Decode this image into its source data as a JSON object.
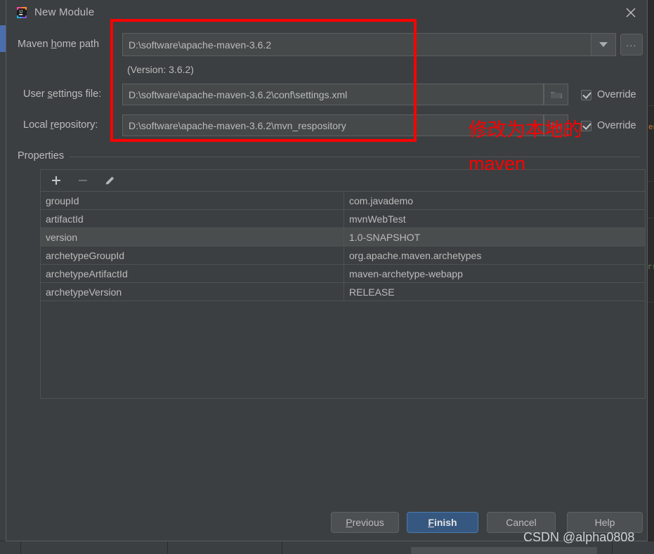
{
  "window": {
    "title": "New Module",
    "app_icon": "intellij-idea-icon",
    "close_icon": "close-icon"
  },
  "form": {
    "maven_home": {
      "label_pre": "Maven ",
      "label_mnemonic": "h",
      "label_post": "ome path",
      "value": "D:\\software\\apache-maven-3.6.2",
      "dropdown_icon": "chevron-down-icon",
      "browse_label": "..."
    },
    "version_note": "(Version: 3.6.2)",
    "user_settings": {
      "label_pre": "User ",
      "label_mnemonic": "s",
      "label_post": "ettings file:",
      "value": "D:\\software\\apache-maven-3.6.2\\conf\\settings.xml",
      "folder_icon": "folder-icon",
      "override_label": "Override",
      "override_checked": true
    },
    "local_repository": {
      "label_pre": "Local ",
      "label_mnemonic": "r",
      "label_post": "epository:",
      "value": "D:\\software\\apache-maven-3.6.2\\mvn_respository",
      "folder_icon": "folder-icon",
      "override_label": "Override",
      "override_checked": true
    }
  },
  "properties": {
    "group_title": "Properties",
    "toolbar": [
      {
        "name": "add-property-icon",
        "glyph": "+",
        "enabled": true
      },
      {
        "name": "remove-property-icon",
        "glyph": "−",
        "enabled": false
      },
      {
        "name": "edit-property-icon",
        "glyph": "pencil",
        "enabled": true
      }
    ],
    "rows": [
      {
        "key": "groupId",
        "value": "com.javademo",
        "selected": false
      },
      {
        "key": "artifactId",
        "value": "mvnWebTest",
        "selected": false
      },
      {
        "key": "version",
        "value": "1.0-SNAPSHOT",
        "selected": true
      },
      {
        "key": "archetypeGroupId",
        "value": "org.apache.maven.archetypes",
        "selected": false
      },
      {
        "key": "archetypeArtifactId",
        "value": "maven-archetype-webapp",
        "selected": false
      },
      {
        "key": "archetypeVersion",
        "value": "RELEASE",
        "selected": false
      }
    ]
  },
  "buttons": {
    "previous": {
      "pre": "",
      "mnemonic": "P",
      "post": "revious"
    },
    "finish": {
      "pre": "",
      "mnemonic": "F",
      "post": "inish"
    },
    "cancel": {
      "label": "Cancel"
    },
    "help": {
      "label": "Help"
    }
  },
  "annotation": {
    "line1": "修改为本地的",
    "line2": "maven",
    "color": "#fe0000"
  },
  "watermark": "CSDN @alpha0808",
  "background": {
    "code_a": "en",
    "code_b": "rs"
  },
  "colors": {
    "dialog_bg": "#3c3f41",
    "field_bg": "#45494a",
    "accent": "#365880",
    "text": "#bbbbbb",
    "annotation": "#fe0000"
  }
}
